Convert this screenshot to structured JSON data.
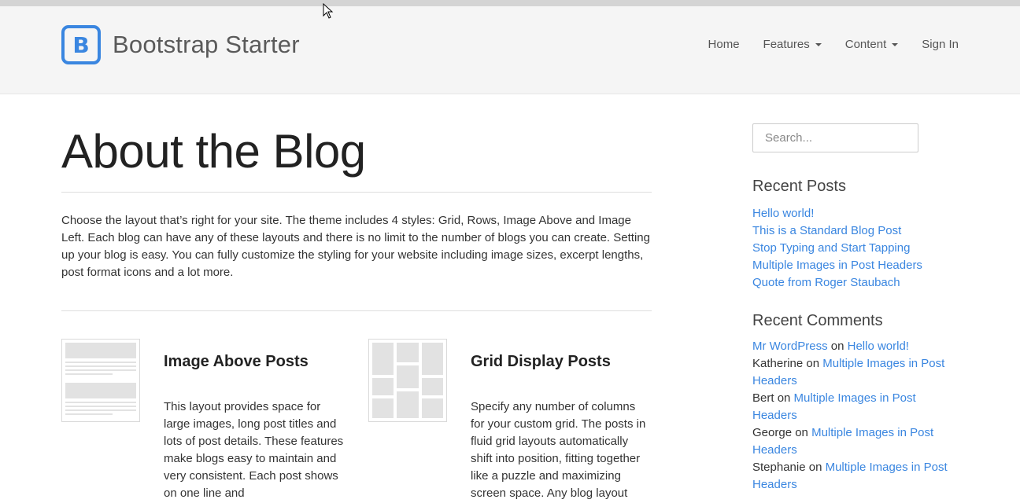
{
  "brand": {
    "logo_letter": "B",
    "name": "Bootstrap Starter",
    "accent": "#3a86e0"
  },
  "nav": {
    "items": [
      {
        "label": "Home",
        "dropdown": false
      },
      {
        "label": "Features",
        "dropdown": true
      },
      {
        "label": "Content",
        "dropdown": true
      },
      {
        "label": "Sign In",
        "dropdown": false
      }
    ]
  },
  "page": {
    "title": "About the Blog",
    "intro": "Choose the layout that’s right for your site. The theme includes 4 styles: Grid, Rows, Image Above and Image Left. Each blog can have any of these layouts and there is no limit to the number of blogs you can create. Setting up your blog is easy. You can fully customize the styling for your website including image sizes, excerpt lengths, post format icons and a lot more."
  },
  "features": [
    {
      "title": "Image Above Posts",
      "icon": "image-above-layout-icon",
      "description": "This layout provides space for large images, long post titles and lots of post details. These features make blogs easy to maintain and very consistent. Each post shows on one line and"
    },
    {
      "title": "Grid Display Posts",
      "icon": "grid-layout-icon",
      "description": "Specify any number of columns for your custom grid. The posts in fluid grid layouts automatically shift into position, fitting together like a puzzle and maximizing screen space. Any blog layout"
    }
  ],
  "sidebar": {
    "search_placeholder": "Search...",
    "recent_posts_heading": "Recent Posts",
    "recent_posts": [
      "Hello world!",
      "This is a Standard Blog Post",
      "Stop Typing and Start Tapping",
      "Multiple Images in Post Headers",
      "Quote from Roger Staubach"
    ],
    "recent_comments_heading": "Recent Comments",
    "on_word": "on",
    "recent_comments": [
      {
        "author": "Mr WordPress",
        "author_is_link": true,
        "post": "Hello world!"
      },
      {
        "author": "Katherine",
        "author_is_link": false,
        "post": "Multiple Images in Post Headers"
      },
      {
        "author": "Bert",
        "author_is_link": false,
        "post": "Multiple Images in Post Headers"
      },
      {
        "author": "George",
        "author_is_link": false,
        "post": "Multiple Images in Post Headers"
      },
      {
        "author": "Stephanie",
        "author_is_link": false,
        "post": "Multiple Images in Post Headers"
      }
    ]
  }
}
